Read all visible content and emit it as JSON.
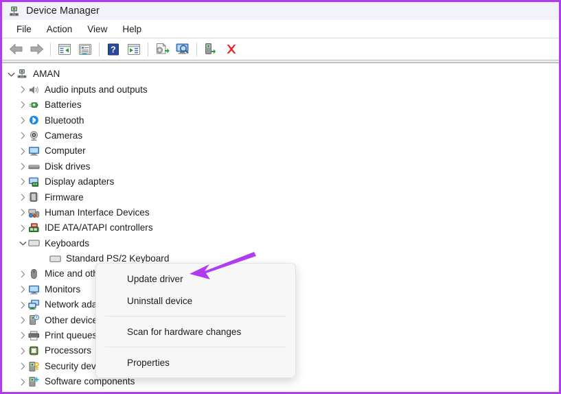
{
  "window": {
    "title": "Device Manager",
    "title_icon": "device-manager-icon",
    "accent_border": "#b13bf0",
    "titlebar_bg": "#f2f2fa"
  },
  "menubar": {
    "items": [
      {
        "label": "File",
        "name": "menu-file"
      },
      {
        "label": "Action",
        "name": "menu-action"
      },
      {
        "label": "View",
        "name": "menu-view"
      },
      {
        "label": "Help",
        "name": "menu-help"
      }
    ]
  },
  "toolbar": {
    "buttons": [
      {
        "name": "back-arrow-icon",
        "tip": "Back"
      },
      {
        "name": "forward-arrow-icon",
        "tip": "Forward"
      },
      {
        "name": "separator-1",
        "tip": ""
      },
      {
        "name": "show-hidden-devices-icon",
        "tip": "Show hidden devices"
      },
      {
        "name": "properties-icon",
        "tip": "Properties"
      },
      {
        "name": "separator-2",
        "tip": ""
      },
      {
        "name": "help-icon",
        "tip": "Help"
      },
      {
        "name": "view-details-icon",
        "tip": "View"
      },
      {
        "name": "separator-3",
        "tip": ""
      },
      {
        "name": "update-driver-icon",
        "tip": "Update driver"
      },
      {
        "name": "scan-hardware-changes-icon",
        "tip": "Scan for hardware changes"
      },
      {
        "name": "separator-4",
        "tip": ""
      },
      {
        "name": "enable-device-icon",
        "tip": "Enable device"
      },
      {
        "name": "uninstall-device-icon",
        "tip": "Uninstall device"
      }
    ]
  },
  "tree": {
    "root": {
      "label": "AMAN",
      "icon": "computer-root-icon",
      "expanded": true
    },
    "nodes": [
      {
        "label": "Audio inputs and outputs",
        "icon": "speaker-icon",
        "expanded": false,
        "selected": false,
        "indent": 1
      },
      {
        "label": "Batteries",
        "icon": "battery-icon",
        "expanded": false,
        "selected": false,
        "indent": 1
      },
      {
        "label": "Bluetooth",
        "icon": "bluetooth-icon",
        "expanded": false,
        "selected": false,
        "indent": 1
      },
      {
        "label": "Cameras",
        "icon": "camera-icon",
        "expanded": false,
        "selected": false,
        "indent": 1
      },
      {
        "label": "Computer",
        "icon": "monitor-icon",
        "expanded": false,
        "selected": false,
        "indent": 1
      },
      {
        "label": "Disk drives",
        "icon": "disk-drive-icon",
        "expanded": false,
        "selected": false,
        "indent": 1
      },
      {
        "label": "Display adapters",
        "icon": "display-adapter-icon",
        "expanded": false,
        "selected": false,
        "indent": 1
      },
      {
        "label": "Firmware",
        "icon": "firmware-chip-icon",
        "expanded": false,
        "selected": false,
        "indent": 1
      },
      {
        "label": "Human Interface Devices",
        "icon": "hid-icon",
        "expanded": false,
        "selected": false,
        "indent": 1
      },
      {
        "label": "IDE ATA/ATAPI controllers",
        "icon": "ide-controller-icon",
        "expanded": false,
        "selected": false,
        "indent": 1
      },
      {
        "label": "Keyboards",
        "icon": "keyboard-icon",
        "expanded": true,
        "selected": false,
        "indent": 1
      },
      {
        "label": "Standard PS/2 Keyboard",
        "icon": "keyboard-icon",
        "expanded": null,
        "selected": true,
        "indent": 2
      },
      {
        "label": "Mice and other pointing devices",
        "icon": "mouse-icon",
        "expanded": false,
        "selected": false,
        "indent": 1
      },
      {
        "label": "Monitors",
        "icon": "monitor-icon",
        "expanded": false,
        "selected": false,
        "indent": 1
      },
      {
        "label": "Network adapters",
        "icon": "network-icon",
        "expanded": false,
        "selected": false,
        "indent": 1
      },
      {
        "label": "Other devices",
        "icon": "other-device-icon",
        "expanded": false,
        "selected": false,
        "indent": 1
      },
      {
        "label": "Print queues",
        "icon": "printer-icon",
        "expanded": false,
        "selected": false,
        "indent": 1
      },
      {
        "label": "Processors",
        "icon": "processor-icon",
        "expanded": false,
        "selected": false,
        "indent": 1
      },
      {
        "label": "Security devices",
        "icon": "security-device-icon",
        "expanded": false,
        "selected": false,
        "indent": 1
      },
      {
        "label": "Software components",
        "icon": "software-component-icon",
        "expanded": false,
        "selected": false,
        "indent": 1
      }
    ],
    "selection_color": "#cde8f7"
  },
  "context_menu": {
    "items": [
      {
        "label": "Update driver",
        "name": "ctx-update-driver",
        "type": "item"
      },
      {
        "label": "Uninstall device",
        "name": "ctx-uninstall-device",
        "type": "item"
      },
      {
        "label": "",
        "name": "ctx-separator-1",
        "type": "separator"
      },
      {
        "label": "Scan for hardware changes",
        "name": "ctx-scan-hardware-changes",
        "type": "item"
      },
      {
        "label": "",
        "name": "ctx-separator-2",
        "type": "separator"
      },
      {
        "label": "Properties",
        "name": "ctx-properties",
        "type": "item"
      }
    ]
  },
  "annotation": {
    "arrow_color": "#b13bf0",
    "points_to": "Update driver"
  }
}
